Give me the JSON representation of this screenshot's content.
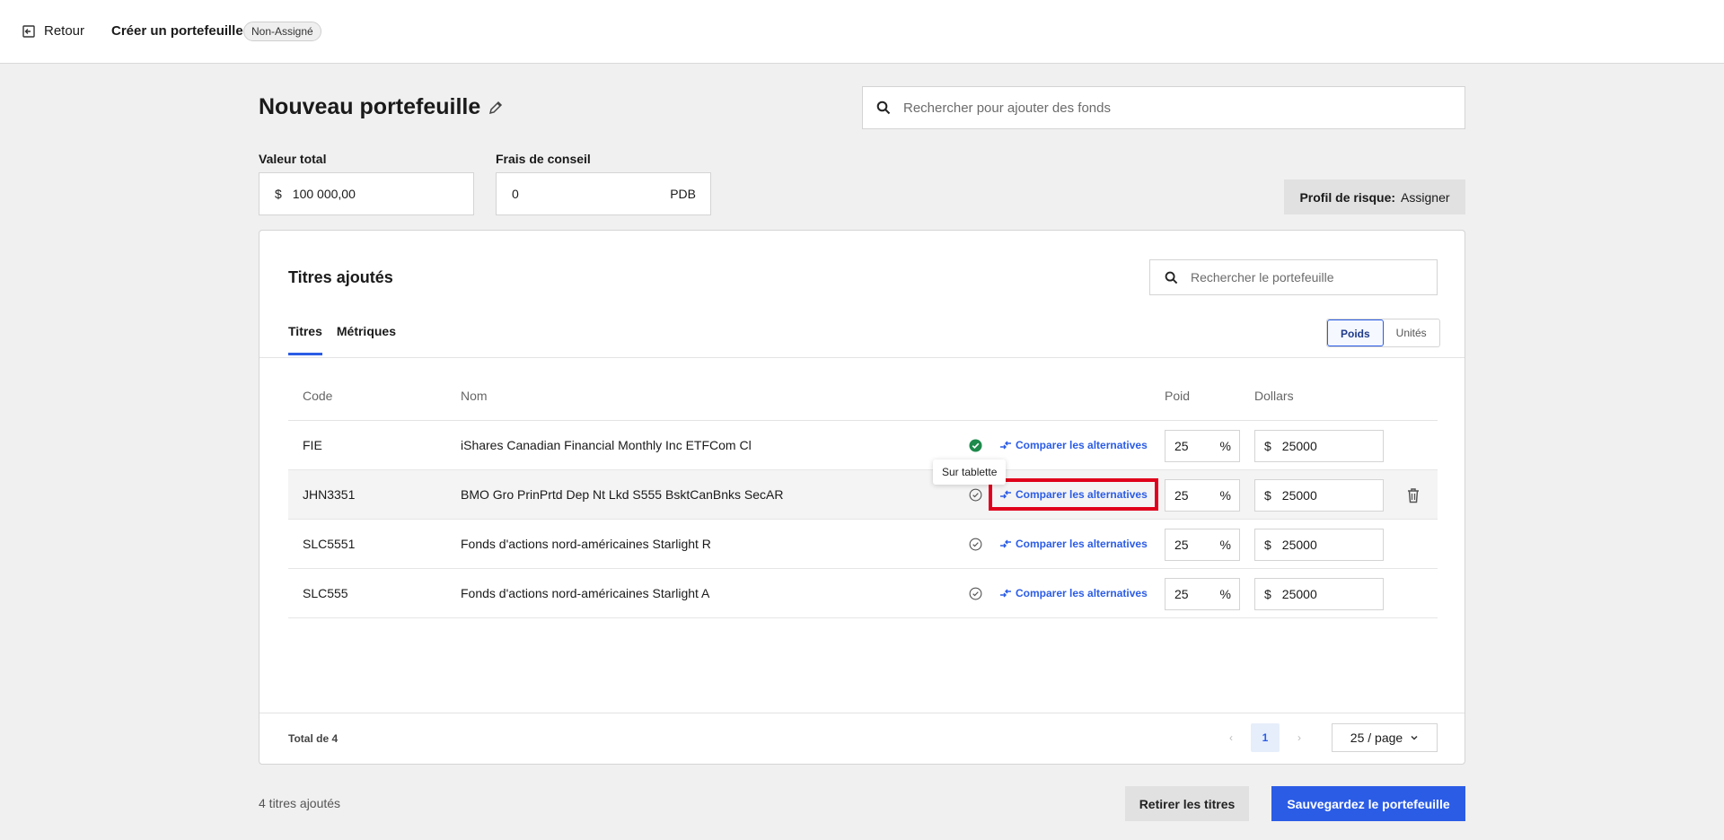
{
  "topbar": {
    "back_label": "Retour",
    "title": "Créer un portefeuille",
    "badge": "Non-Assigné"
  },
  "page": {
    "title": "Nouveau portefeuille",
    "search_placeholder": "Rechercher pour ajouter des fonds"
  },
  "fields": {
    "total_label": "Valeur total",
    "total_prefix": "$",
    "total_value": "100 000,00",
    "fees_label": "Frais de conseil",
    "fees_value": "0",
    "fees_suffix": "PDB"
  },
  "risk": {
    "label": "Profil de risque:",
    "value": "Assigner"
  },
  "card": {
    "title": "Titres ajoutés",
    "search_placeholder": "Rechercher le portefeuille",
    "tabs": [
      {
        "label": "Titres",
        "active": true
      },
      {
        "label": "Métriques",
        "active": false
      }
    ],
    "toggle": [
      {
        "label": "Poids",
        "active": true
      },
      {
        "label": "Unités",
        "active": false
      }
    ],
    "columns": {
      "code": "Code",
      "name": "Nom",
      "weight": "Poid",
      "dollars": "Dollars"
    },
    "compare_label": "Comparer les alternatives",
    "rows": [
      {
        "code": "FIE",
        "name": "iShares Canadian Financial Monthly Inc ETFCom Cl",
        "status": "verified",
        "weight": "25",
        "weight_unit": "%",
        "currency": "$",
        "dollars": "25000"
      },
      {
        "code": "JHN3351",
        "name": "BMO Gro PrinPrtd Dep Nt Lkd S555 BsktCanBnks SecAR",
        "status": "pending",
        "weight": "25",
        "weight_unit": "%",
        "currency": "$",
        "dollars": "25000"
      },
      {
        "code": "SLC5551",
        "name": "Fonds d'actions nord-américaines Starlight R",
        "status": "pending",
        "weight": "25",
        "weight_unit": "%",
        "currency": "$",
        "dollars": "25000"
      },
      {
        "code": "SLC555",
        "name": "Fonds d'actions nord-américaines Starlight A",
        "status": "pending",
        "weight": "25",
        "weight_unit": "%",
        "currency": "$",
        "dollars": "25000"
      }
    ],
    "tooltip": "Sur tablette",
    "total": "Total de 4",
    "pagination": {
      "current_page": "1",
      "page_size": "25 / page"
    }
  },
  "footer": {
    "added_count": "4 titres ajoutés",
    "remove_label": "Retirer les titres",
    "save_label": "Sauvegardez le portefeuille"
  },
  "colors": {
    "primary": "#2b5ce6",
    "verified": "#1e8a4c",
    "highlight": "#e0001b"
  }
}
